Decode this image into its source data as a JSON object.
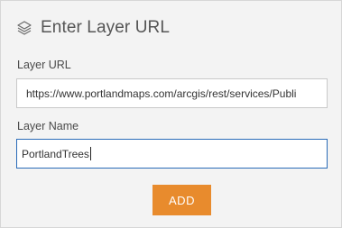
{
  "header": {
    "title": "Enter Layer URL",
    "icon": "layers-icon"
  },
  "layer_url": {
    "label": "Layer URL",
    "value": "https://www.portlandmaps.com/arcgis/rest/services/Publi"
  },
  "layer_name": {
    "label": "Layer Name",
    "value": "PortlandTrees"
  },
  "actions": {
    "add_label": "ADD"
  },
  "colors": {
    "accent": "#e88b2d",
    "focus_border": "#2a6bb8",
    "panel_bg": "#f3f3f3"
  }
}
